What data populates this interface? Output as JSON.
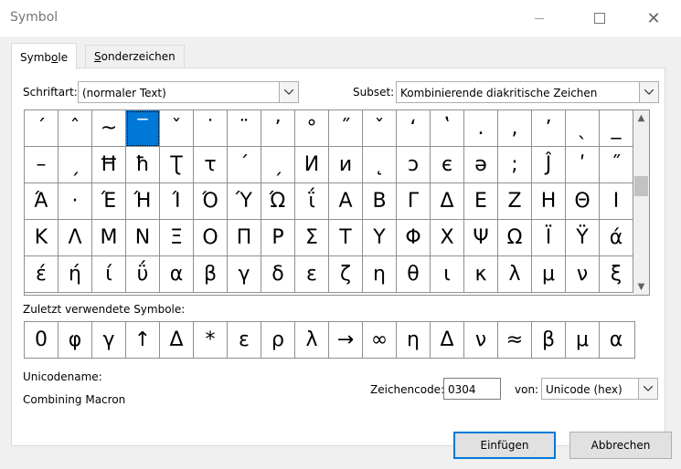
{
  "window": {
    "title": "Symbol"
  },
  "tabs": [
    {
      "label": "Symbole",
      "hotkey_index": 4
    },
    {
      "label": "Sonderzeichen",
      "hotkey_index": 0
    }
  ],
  "font": {
    "label": "Schriftart:",
    "value": "(normaler Text)"
  },
  "subset": {
    "label": "Subset:",
    "value": "Kombinierende diakritische Zeichen"
  },
  "grid": {
    "selected_index": 3,
    "rows": [
      [
        "ˊ",
        "ˆ",
        "~",
        "‾",
        "ˇ",
        "˙",
        "¨",
        "ʼ",
        "°",
        "˝",
        "ˇ",
        "ʻ",
        "ʽ",
        ".",
        ",",
        "ʼ",
        "ˎ",
        "_"
      ],
      [
        "–",
        "ˏ",
        "Ħ",
        "ħ",
        "Ʈ",
        "τ",
        "ˊ",
        "ˏ",
        "И",
        "и",
        "˛",
        "ɔ",
        "є",
        "ə",
        ";",
        "Ĵ",
        "ʹ",
        "˝"
      ],
      [
        "Ά",
        "·",
        "Έ",
        "Ή",
        "Ί",
        "Ό",
        "Ύ",
        "Ώ",
        "ΐ",
        "Α",
        "Β",
        "Γ",
        "Δ",
        "Ε",
        "Ζ",
        "Η",
        "Θ",
        "Ι"
      ],
      [
        "Κ",
        "Λ",
        "Μ",
        "Ν",
        "Ξ",
        "Ο",
        "Π",
        "Ρ",
        "Σ",
        "Τ",
        "Υ",
        "Φ",
        "Χ",
        "Ψ",
        "Ω",
        "Ϊ",
        "Ϋ",
        "ά"
      ],
      [
        "έ",
        "ή",
        "ί",
        "ΰ",
        "α",
        "β",
        "γ",
        "δ",
        "ε",
        "ζ",
        "η",
        "θ",
        "ι",
        "κ",
        "λ",
        "μ",
        "ν",
        "ξ"
      ]
    ]
  },
  "recent": {
    "label": "Zuletzt verwendete Symbole:",
    "symbols": [
      "0",
      "φ",
      "γ",
      "↑",
      "Δ",
      "*",
      "ε",
      "ρ",
      "λ",
      "→",
      "∞",
      "η",
      "Δ",
      "ν",
      "≈",
      "β",
      "μ",
      "α"
    ]
  },
  "unicode_name": {
    "label": "Unicodename:",
    "value": "Combining Macron"
  },
  "char_code": {
    "label": "Zeichencode:",
    "value": "0304"
  },
  "from": {
    "label": "von:",
    "value": "Unicode (hex)"
  },
  "buttons": {
    "insert": "Einfügen",
    "cancel": "Abbrechen"
  }
}
